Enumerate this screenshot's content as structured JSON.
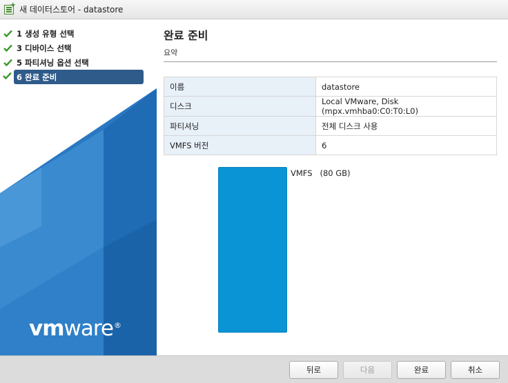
{
  "window": {
    "title": "새 데이터스토어 - datastore",
    "icon": "add-datastore-icon"
  },
  "steps": [
    {
      "label": "1 생성 유형 선택",
      "completed": true
    },
    {
      "label": "3 디바이스 선택",
      "completed": true
    },
    {
      "label": "5 파티셔닝 옵션 선택",
      "completed": true
    },
    {
      "label": "6 완료 준비",
      "completed": true,
      "active": true
    }
  ],
  "brand": {
    "logo_vm": "vm",
    "logo_ware": "ware",
    "logo_reg": "®"
  },
  "main": {
    "title": "완료 준비",
    "subtitle": "요약",
    "summary": [
      {
        "key": "이름",
        "value": "datastore"
      },
      {
        "key": "디스크",
        "value": "Local VMware, Disk (mpx.vmhba0:C0:T0:L0)"
      },
      {
        "key": "파티셔닝",
        "value": "전체 디스크 사용"
      },
      {
        "key": "VMFS 버전",
        "value": "6"
      }
    ],
    "volume_label": "VMFS   (80 GB)",
    "volume_color": "#0a94d5"
  },
  "footer": {
    "back": "뒤로",
    "next": "다음",
    "finish": "완료",
    "cancel": "취소"
  },
  "colors": {
    "accent": "#2f5b8a",
    "check": "#3a9a2a",
    "sidebar_blue": "#2a78c2"
  }
}
